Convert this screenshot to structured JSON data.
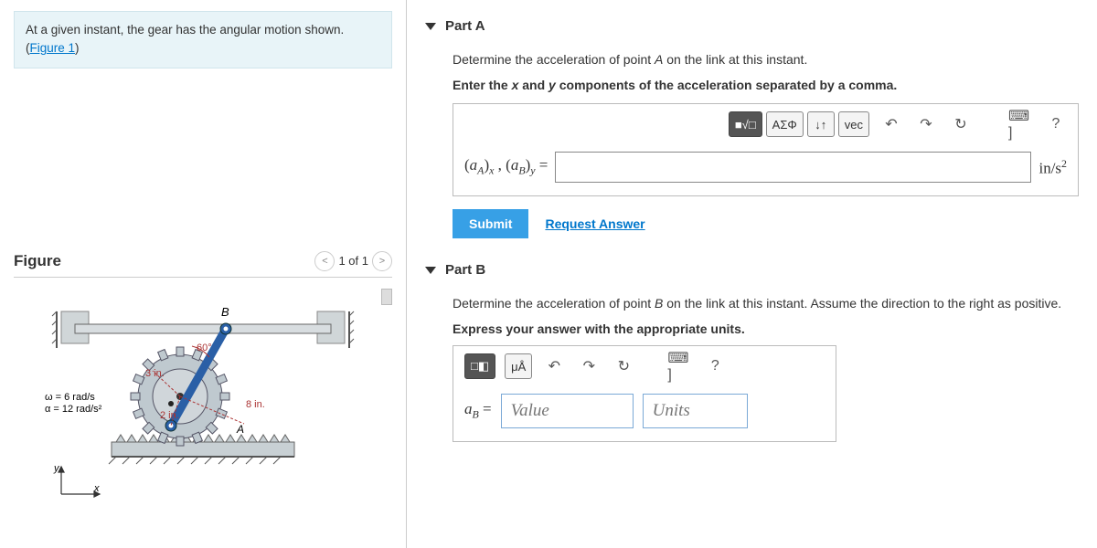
{
  "intro": {
    "text_before": "At a given instant, the gear has the angular motion shown. (",
    "link_text": "Figure 1",
    "text_after": ")"
  },
  "figure": {
    "title": "Figure",
    "pager": "1 of 1",
    "labels": {
      "B": "B",
      "A": "A",
      "angle": "60°",
      "r1": "3 in.",
      "r2": "2 in.",
      "r3": "8 in.",
      "omega": "ω = 6 rad/s",
      "alpha": "α = 12 rad/s²",
      "x": "x",
      "y": "y"
    }
  },
  "partA": {
    "title": "Part A",
    "prompt1": "Determine the acceleration of point A on the link at this instant.",
    "prompt2": "Enter the x and y components of the acceleration separated by a comma.",
    "toolbar": {
      "templates": "■√□",
      "greek": "ΑΣΦ",
      "subsup": "↓↑",
      "vec": "vec",
      "undo": "↶",
      "redo": "↷",
      "reset": "↻",
      "keyboard": "⌨ ]",
      "help": "?"
    },
    "lhs": "(aA)x , (aB)y =",
    "units": "in/s²",
    "submit": "Submit",
    "request": "Request Answer"
  },
  "partB": {
    "title": "Part B",
    "prompt1": "Determine the acceleration of point B on the link at this instant. Assume the direction to the right as positive.",
    "prompt2": "Express your answer with the appropriate units.",
    "toolbar": {
      "templates": "□◧",
      "units_btn": "μÅ",
      "undo": "↶",
      "redo": "↷",
      "reset": "↻",
      "keyboard": "⌨ ]",
      "help": "?"
    },
    "lhs": "aB =",
    "value_placeholder": "Value",
    "units_placeholder": "Units"
  }
}
